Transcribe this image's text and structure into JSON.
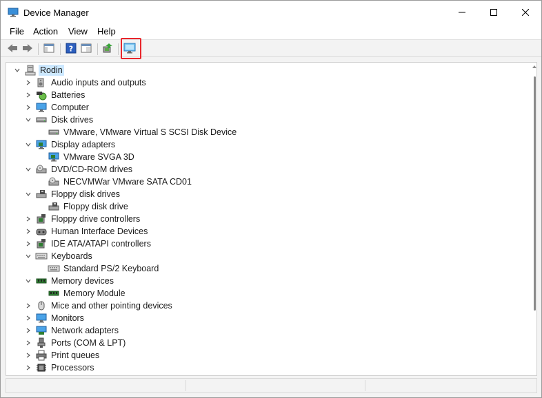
{
  "window": {
    "title": "Device Manager"
  },
  "menu": {
    "items": [
      "File",
      "Action",
      "View",
      "Help"
    ]
  },
  "toolbar": {
    "buttons": [
      "back-arrow-icon",
      "forward-arrow-icon",
      "show-hide-console-tree-icon",
      "help-icon",
      "properties-icon",
      "update-driver-icon",
      "scan-hardware-changes-icon"
    ],
    "highlighted": "scan-hardware-changes-icon"
  },
  "tree": {
    "root": "Rodin",
    "rows": [
      {
        "label": "Audio inputs and outputs",
        "level": 1,
        "expanded": false,
        "icon": "speaker-icon"
      },
      {
        "label": "Batteries",
        "level": 1,
        "expanded": false,
        "icon": "battery-icon"
      },
      {
        "label": "Computer",
        "level": 1,
        "expanded": false,
        "icon": "computer-icon"
      },
      {
        "label": "Disk drives",
        "level": 1,
        "expanded": true,
        "icon": "disk-drive-icon"
      },
      {
        "label": "VMware, VMware Virtual S SCSI Disk Device",
        "level": 2,
        "icon": "disk-drive-icon"
      },
      {
        "label": "Display adapters",
        "level": 1,
        "expanded": true,
        "icon": "display-adapter-icon"
      },
      {
        "label": "VMware SVGA 3D",
        "level": 2,
        "icon": "display-adapter-icon"
      },
      {
        "label": "DVD/CD-ROM drives",
        "level": 1,
        "expanded": true,
        "icon": "dvd-drive-icon"
      },
      {
        "label": "NECVMWar VMware SATA CD01",
        "level": 2,
        "icon": "dvd-drive-icon"
      },
      {
        "label": "Floppy disk drives",
        "level": 1,
        "expanded": true,
        "icon": "floppy-drive-icon"
      },
      {
        "label": "Floppy disk drive",
        "level": 2,
        "icon": "floppy-drive-icon"
      },
      {
        "label": "Floppy drive controllers",
        "level": 1,
        "expanded": false,
        "icon": "controller-icon"
      },
      {
        "label": "Human Interface Devices",
        "level": 1,
        "expanded": false,
        "icon": "hid-icon"
      },
      {
        "label": "IDE ATA/ATAPI controllers",
        "level": 1,
        "expanded": false,
        "icon": "controller-icon"
      },
      {
        "label": "Keyboards",
        "level": 1,
        "expanded": true,
        "icon": "keyboard-icon"
      },
      {
        "label": "Standard PS/2 Keyboard",
        "level": 2,
        "icon": "keyboard-icon"
      },
      {
        "label": "Memory devices",
        "level": 1,
        "expanded": true,
        "icon": "memory-icon"
      },
      {
        "label": "Memory Module",
        "level": 2,
        "icon": "memory-icon"
      },
      {
        "label": "Mice and other pointing devices",
        "level": 1,
        "expanded": false,
        "icon": "mouse-icon"
      },
      {
        "label": "Monitors",
        "level": 1,
        "expanded": false,
        "icon": "monitor-icon"
      },
      {
        "label": "Network adapters",
        "level": 1,
        "expanded": false,
        "icon": "network-adapter-icon"
      },
      {
        "label": "Ports (COM & LPT)",
        "level": 1,
        "expanded": false,
        "icon": "port-icon"
      },
      {
        "label": "Print queues",
        "level": 1,
        "expanded": false,
        "icon": "printer-icon"
      },
      {
        "label": "Processors",
        "level": 1,
        "expanded": false,
        "icon": "processor-icon"
      }
    ]
  }
}
